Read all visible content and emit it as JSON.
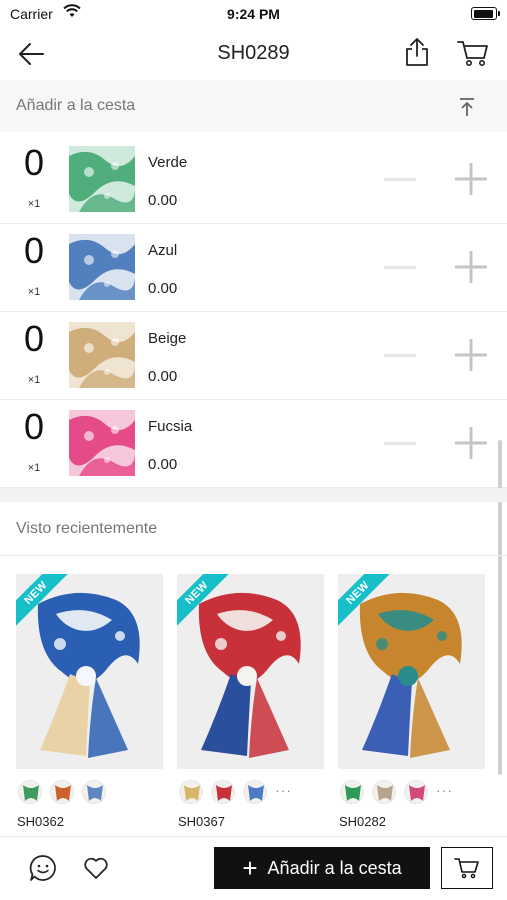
{
  "status_bar": {
    "carrier": "Carrier",
    "time": "9:24 PM"
  },
  "nav": {
    "title": "SH0289",
    "icons": [
      "back-arrow-icon",
      "share-icon",
      "cart-icon"
    ]
  },
  "add_to_cart_section": {
    "label": "Añadir a la cesta"
  },
  "variants": [
    {
      "qty": "0",
      "multiplier": "×1",
      "name": "Verde",
      "price": "0.00",
      "colors": [
        "#3aa36b",
        "#cfe9dc"
      ]
    },
    {
      "qty": "0",
      "multiplier": "×1",
      "name": "Azul",
      "price": "0.00",
      "colors": [
        "#3b6fb6",
        "#d8e3ef"
      ]
    },
    {
      "qty": "0",
      "multiplier": "×1",
      "name": "Beige",
      "price": "0.00",
      "colors": [
        "#c9a46c",
        "#efe4d2"
      ]
    },
    {
      "qty": "0",
      "multiplier": "×1",
      "name": "Fucsia",
      "price": "0.00",
      "colors": [
        "#e2357a",
        "#f6c7da"
      ]
    }
  ],
  "recent": {
    "label": "Visto recientemente",
    "products": [
      {
        "code": "SH0362",
        "badge": "NEW",
        "colors": [
          "#2b5fb3",
          "#f4f7fb",
          "#e9d2a6"
        ],
        "swatches": [
          "#3f9a5e",
          "#c9632b",
          "#5f86bf"
        ],
        "more": ""
      },
      {
        "code": "SH0367",
        "badge": "NEW",
        "colors": [
          "#c8303a",
          "#f5f3f0",
          "#2a4f9c"
        ],
        "swatches": [
          "#d6b66a",
          "#c8303a",
          "#4e79c4"
        ],
        "more": "···"
      },
      {
        "code": "SH0282",
        "badge": "NEW",
        "colors": [
          "#c7862d",
          "#2a8c8a",
          "#3c5fb6"
        ],
        "swatches": [
          "#2e9a57",
          "#b5a38d",
          "#d14a79"
        ],
        "more": "···"
      }
    ]
  },
  "bottom_bar": {
    "add_label": "Añadir a la cesta",
    "plus": "+"
  }
}
